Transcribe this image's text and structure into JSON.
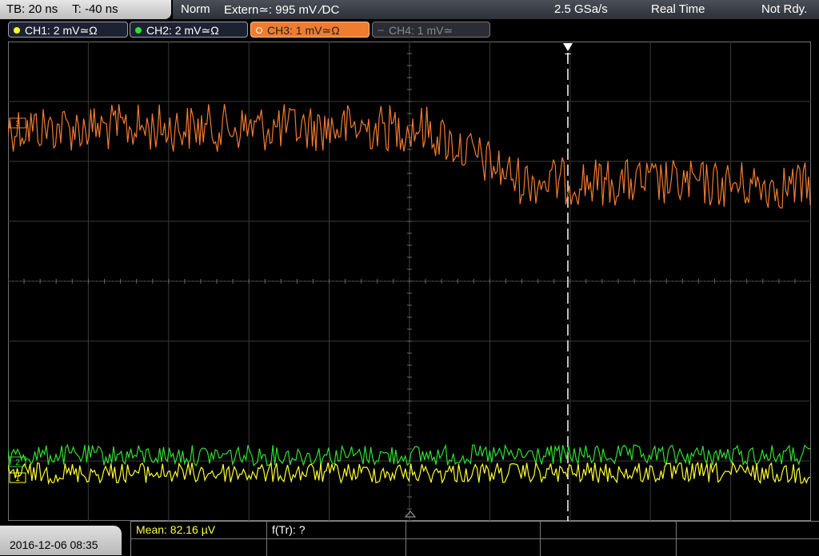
{
  "header": {
    "timebase": "TB: 20 ns",
    "trigger_time": "T: -40 ns",
    "trigger_mode": "Norm",
    "trigger_source": "Extern≃: 995 mV ∕DC",
    "sample_rate": "2.5 GSa/s",
    "acq_mode": "Real Time",
    "status": "Not Rdy."
  },
  "channels": [
    {
      "label": "CH1: 2 mV≃Ω",
      "color": "#ffff30"
    },
    {
      "label": "CH2: 2 mV≃Ω",
      "color": "#30e030"
    },
    {
      "label": "CH3: 1 mV≃Ω",
      "color": "#f07c30"
    },
    {
      "label": "CH4: 1 mV≃",
      "color": "#666666"
    }
  ],
  "markers": {
    "trigger": "T",
    "ch3": "3",
    "ch2": "2",
    "ch1": "1"
  },
  "footer": {
    "datetime": "2016-12-06 08:35",
    "mean": "Mean: 82.16 µV",
    "f_tr": "f(Tr): ?"
  }
}
